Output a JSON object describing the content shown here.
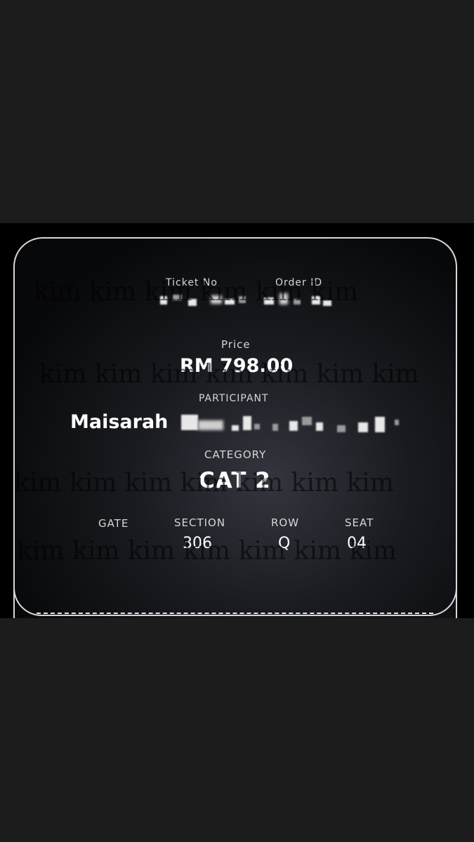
{
  "ticket": {
    "ticket_no_label": "Ticket No",
    "order_id_label": "Order ID",
    "price_label": "Price",
    "price_value": "RM 798.00",
    "participant_label": "PARTICIPANT",
    "participant_name": "Maisarah",
    "category_label": "CATEGORY",
    "category_value": "CAT 2",
    "gate_label": "GATE",
    "section_label": "SECTION",
    "section_value": "306",
    "row_label": "ROW",
    "row_value": "Q",
    "seat_label": "SEAT",
    "seat_value": "04"
  },
  "watermark": {
    "line1": "kim kim kim kim kim kim",
    "line2": "kim kim kim kim kim kim kim",
    "line3": "kim kim kim kim kim kim kim",
    "line4": "kim kim kim kim kim kim kim"
  }
}
